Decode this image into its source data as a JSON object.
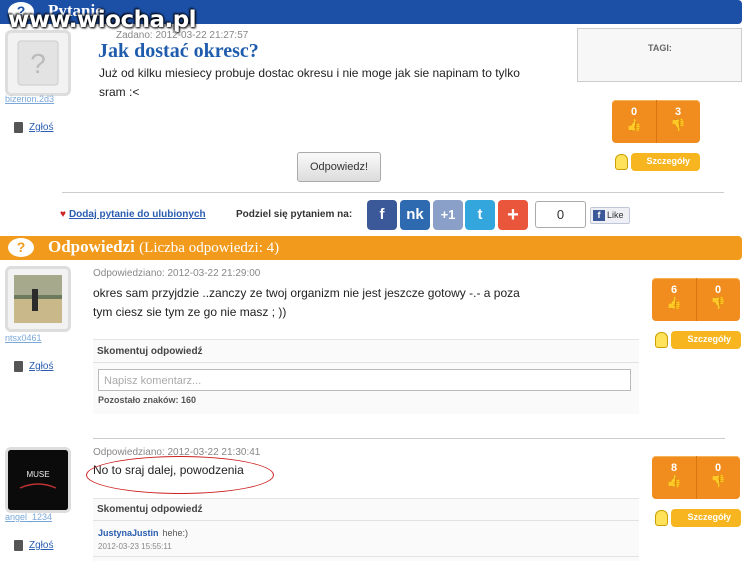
{
  "watermark": "www.wiocha.pl",
  "question_bar": {
    "title": "Pytanie"
  },
  "question": {
    "username": "bizerion.2d3",
    "report_label": "Zgłoś",
    "added": "Zadano: 2012-03-22 21:27:57",
    "title": "Jak dostać okresc?",
    "body_line1": "Już od kilku miesiecy probuje dostac okresu i nie moge jak sie napinam to tylko",
    "body_line2": "sram :<",
    "tags_label": "TAGI:",
    "votes_up": "0",
    "votes_down": "3",
    "details_label": "Szczegóły",
    "answer_button": "Odpowiedz!"
  },
  "share": {
    "favorite_label": "Dodaj pytanie do ulubionych",
    "share_label": "Podziel się pytaniem na:",
    "count": "0",
    "like_label": "Like",
    "buttons": [
      {
        "label": "f",
        "color": "#3b5998",
        "icon": "facebook-icon"
      },
      {
        "label": "nk",
        "color": "#2e6ab0",
        "icon": "nk-icon"
      },
      {
        "label": "+1",
        "color": "#8aa0c8",
        "icon": "google-plus-icon"
      },
      {
        "label": "t",
        "color": "#33a6dd",
        "icon": "twitter-icon"
      },
      {
        "label": "+",
        "color": "#e9563b",
        "icon": "add-share-icon"
      }
    ]
  },
  "answers_bar": {
    "title": "Odpowiedzi",
    "subtitle": "(Liczba odpowiedzi: 4)"
  },
  "answers": [
    {
      "username": "ntsx0461",
      "report_label": "Zgłoś",
      "answered": "Odpowiedziano: 2012-03-22 21:29:00",
      "line1": "okres sam przyjdzie ..zanczy ze twoj organizm nie jest jeszcze gotowy -.- a poza",
      "line2": "tym ciesz sie tym ze go nie masz ; ))",
      "votes_up": "6",
      "votes_down": "0",
      "details_label": "Szczegóły",
      "comment_heading": "Skomentuj odpowiedź",
      "comment_placeholder": "Napisz komentarz...",
      "remaining": "Pozostało znaków: 160"
    },
    {
      "username": "angel_1234",
      "report_label": "Zgłoś",
      "answered": "Odpowiedziano: 2012-03-22 21:30:41",
      "line1": "No to sraj dalej, powodzenia",
      "votes_up": "8",
      "votes_down": "0",
      "details_label": "Szczegóły",
      "comment_heading": "Skomentuj odpowiedź",
      "avatar_text": "MUSE",
      "comment": {
        "author": "JustynaJustin",
        "text": "hehe:)",
        "date": "2012-03-23 15:55:11"
      }
    }
  ]
}
